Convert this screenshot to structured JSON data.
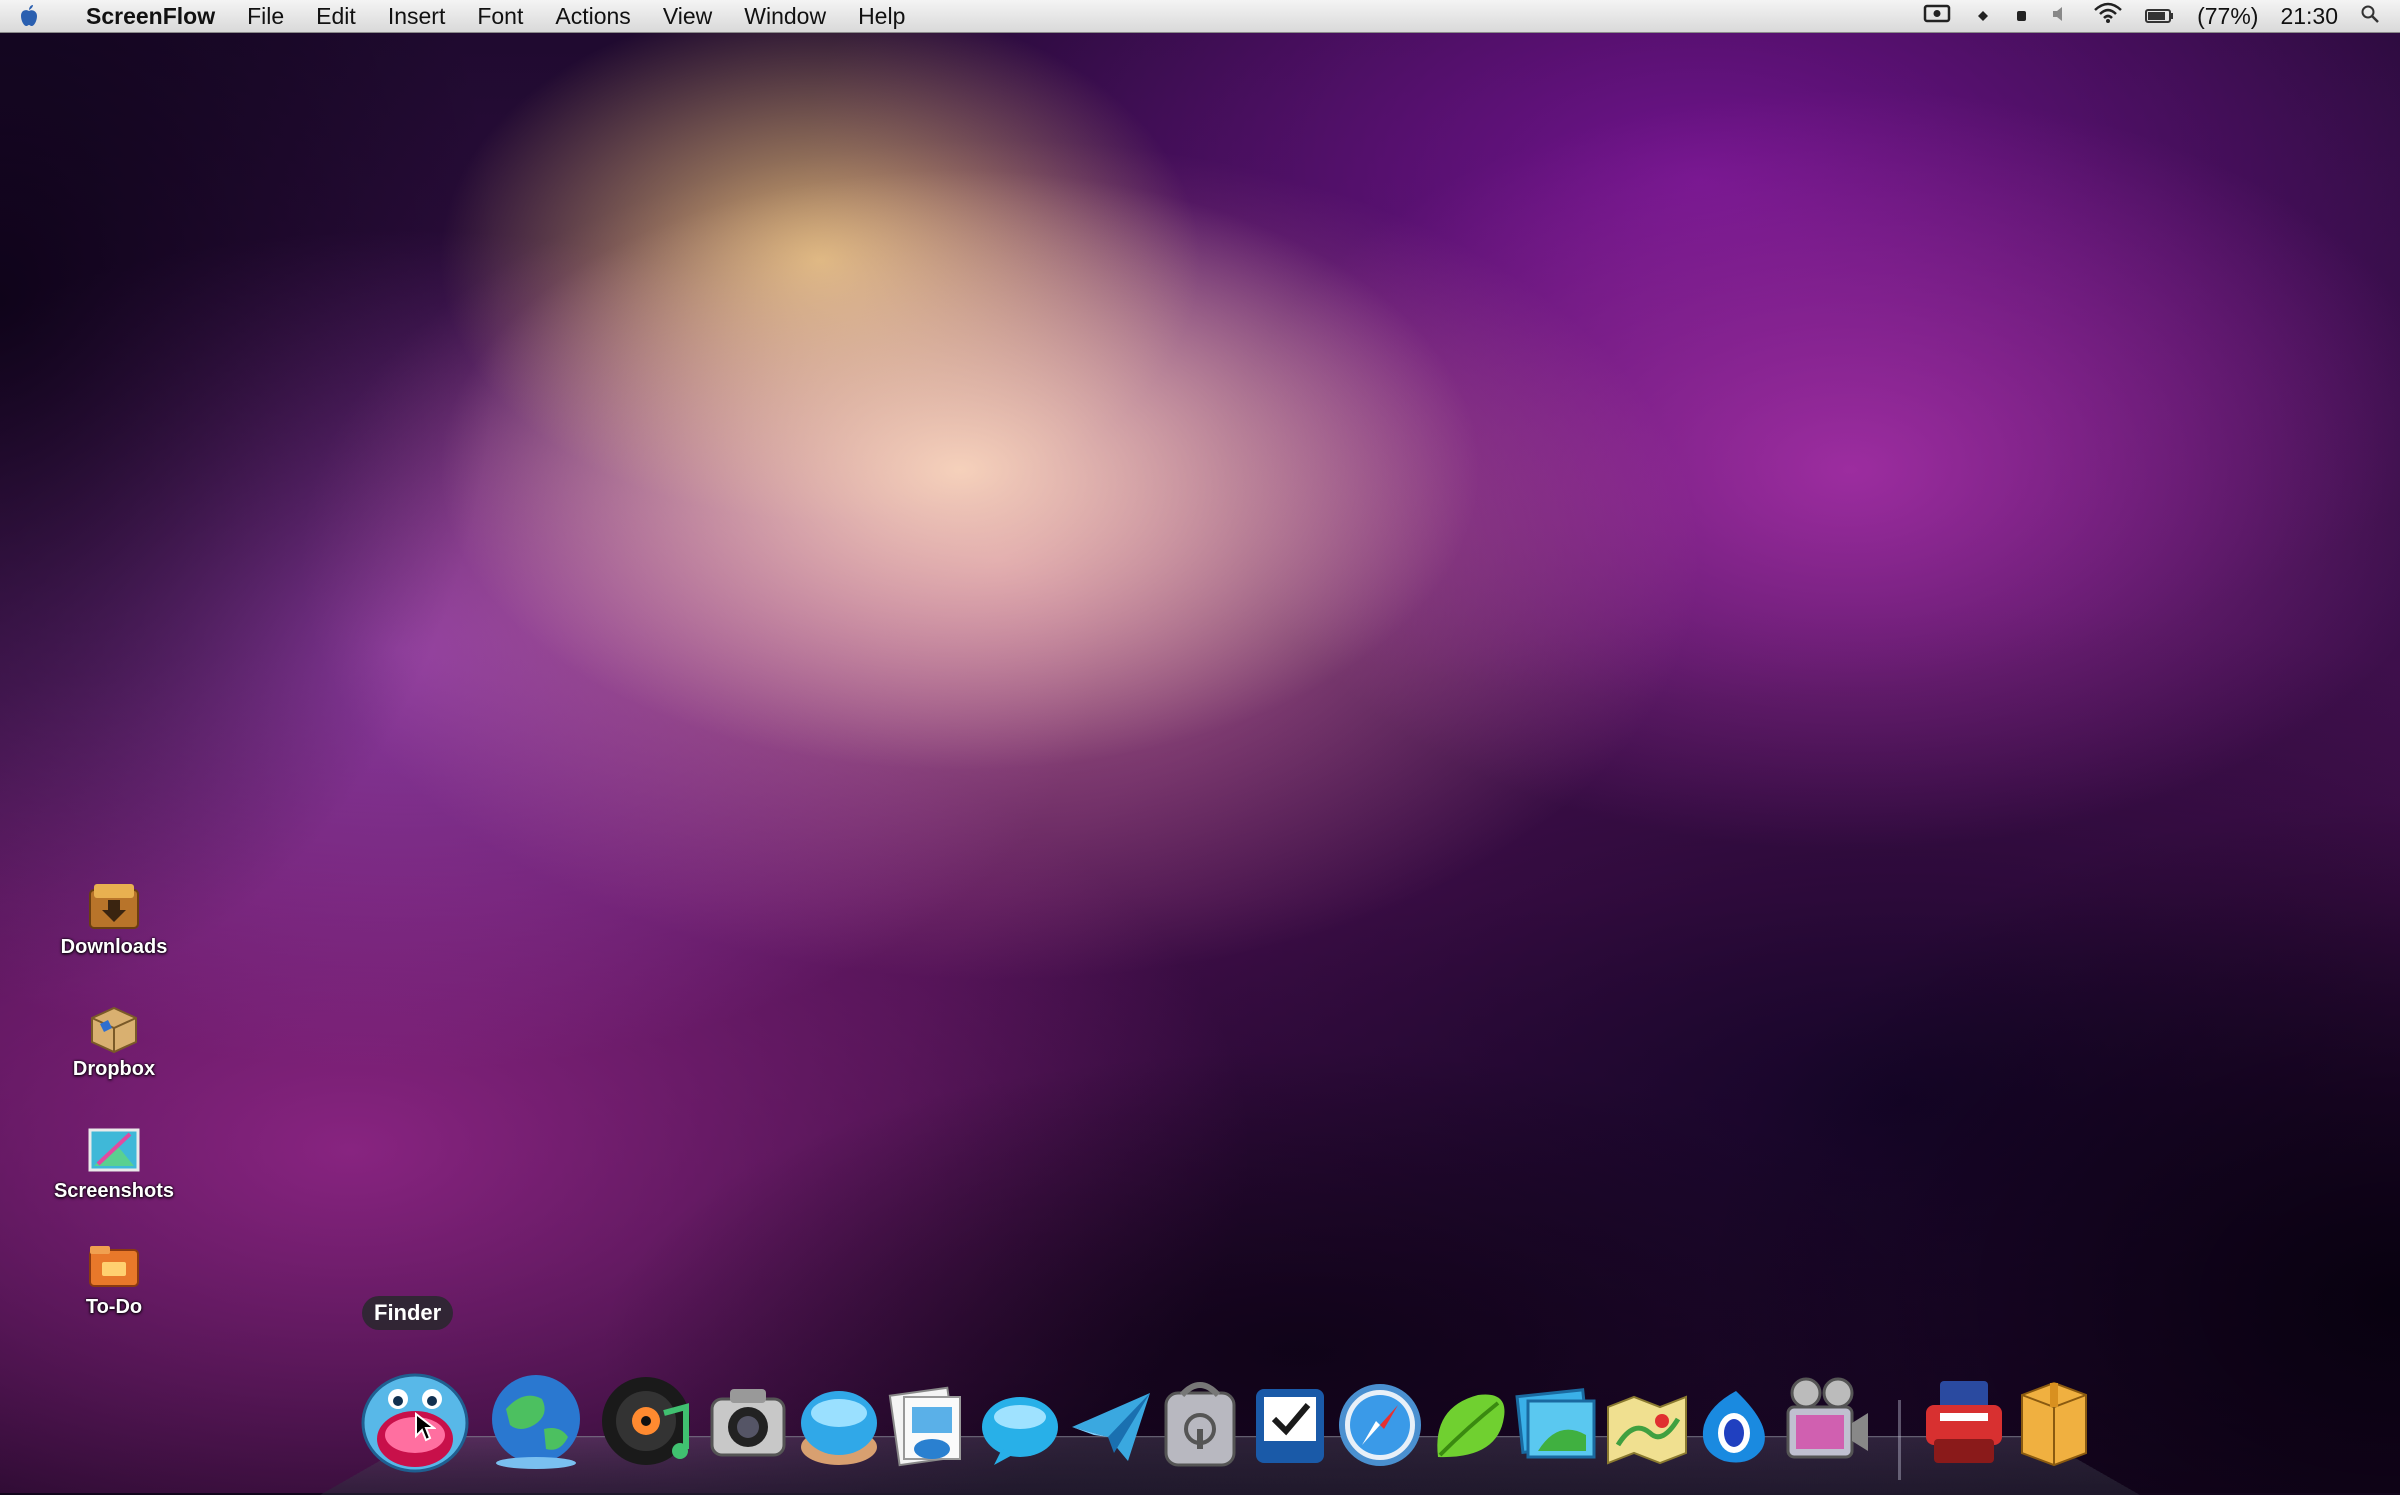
{
  "menubar": {
    "apple_icon": "apple-logo",
    "app_name": "ScreenFlow",
    "menus": [
      "File",
      "Edit",
      "Insert",
      "Font",
      "Actions",
      "View",
      "Window",
      "Help"
    ],
    "status": {
      "battery": "(77%)",
      "clock": "21:30"
    }
  },
  "desktop_icons": [
    {
      "label": "Downloads",
      "icon": "downloads-folder-icon"
    },
    {
      "label": "Dropbox",
      "icon": "dropbox-box-icon"
    },
    {
      "label": "Screenshots",
      "icon": "screenshots-icon"
    },
    {
      "label": "To-Do",
      "icon": "todo-folder-icon"
    }
  ],
  "dock": {
    "tooltip": "Finder",
    "items": [
      "finder-icon",
      "globe-icon",
      "itunes-icon",
      "camera-icon",
      "blue-button-icon",
      "preview-icon",
      "messages-icon",
      "paper-plane-icon",
      "security-icon",
      "tasks-icon",
      "safari-icon",
      "leaf-icon",
      "photos-icon",
      "maps-icon",
      "water-drop-icon",
      "movie-icon",
      "printer-icon",
      "box-icon"
    ]
  }
}
